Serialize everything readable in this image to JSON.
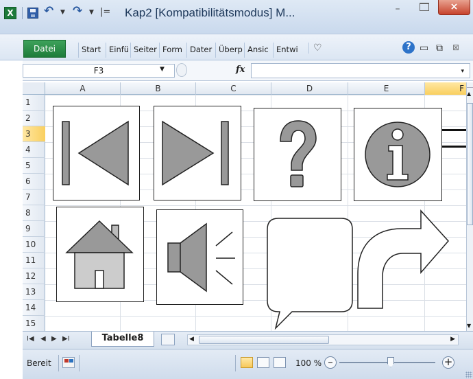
{
  "window": {
    "title": "Kap2  [Kompatibilitätsmodus] M...",
    "app_icon": "X",
    "min_label": "–",
    "close_label": "×"
  },
  "qat": {
    "custom_label": "|="
  },
  "ribbon": {
    "file_tab": "Datei",
    "tabs": [
      "Start",
      "Einfü",
      "Seiter",
      "Form",
      "Dater",
      "Überp",
      "Ansic",
      "Entwi"
    ],
    "help_label": "?"
  },
  "formula_bar": {
    "name_box": "F3",
    "fx_label": "fx",
    "value": ""
  },
  "grid": {
    "columns": [
      "A",
      "B",
      "C",
      "D",
      "E",
      "F"
    ],
    "selected_column": "F",
    "rows": [
      "1",
      "2",
      "3",
      "4",
      "5",
      "6",
      "7",
      "8",
      "9",
      "10",
      "11",
      "12",
      "13",
      "14",
      "15"
    ],
    "selected_row": "3"
  },
  "shapes": [
    {
      "name": "first-track-button",
      "icon": "skip-to-start-icon"
    },
    {
      "name": "last-track-button",
      "icon": "skip-to-end-icon"
    },
    {
      "name": "help-button",
      "icon": "question-mark-icon"
    },
    {
      "name": "info-button",
      "icon": "info-icon"
    },
    {
      "name": "home-button",
      "icon": "house-icon"
    },
    {
      "name": "sound-button",
      "icon": "speaker-icon"
    },
    {
      "name": "speech-bubble",
      "icon": "speech-bubble-icon"
    },
    {
      "name": "curved-arrow",
      "icon": "curved-arrow-icon"
    }
  ],
  "sheet_tabs": {
    "active": "Tabelle8"
  },
  "status": {
    "ready": "Bereit",
    "zoom": "100 %",
    "zoom_minus": "–",
    "zoom_plus": "+",
    "zoom_level_percent": 100
  },
  "colors": {
    "accent_green": "#1e7c3a",
    "selection_gold": "#f9cf5f",
    "shape_fill": "#999999",
    "close_red": "#c7432c"
  }
}
